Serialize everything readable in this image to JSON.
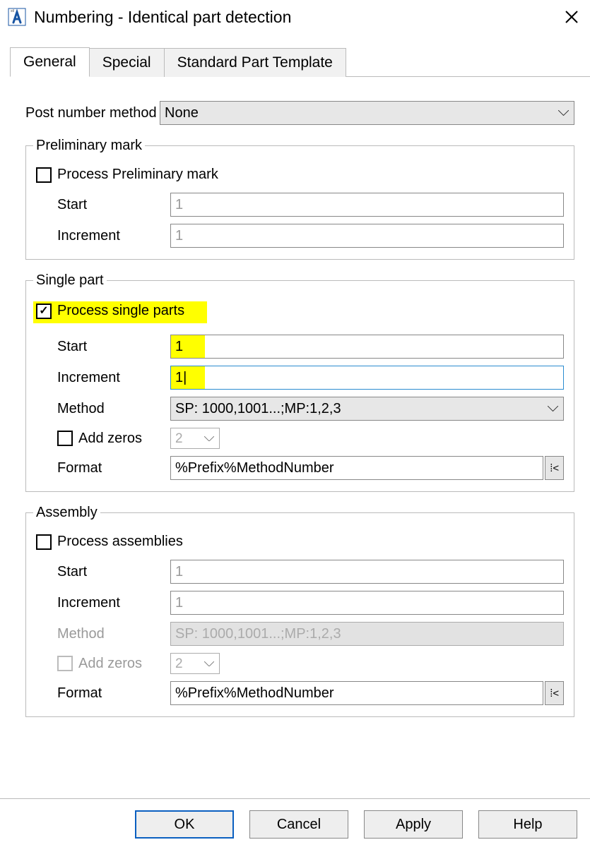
{
  "title": "Numbering - Identical part detection",
  "tabs": {
    "general": "General",
    "special": "Special",
    "template": "Standard Part Template"
  },
  "labels": {
    "post_method": "Post number method",
    "start": "Start",
    "increment": "Increment",
    "method": "Method",
    "add_zeros": "Add zeros",
    "format": "Format"
  },
  "post_method": {
    "value": "None"
  },
  "preliminary": {
    "legend": "Preliminary mark",
    "process_label": "Process Preliminary mark",
    "process_checked": false,
    "start": "1",
    "increment": "1"
  },
  "single": {
    "legend": "Single part",
    "process_label": "Process single parts",
    "process_checked": true,
    "start": "1",
    "increment": "1",
    "method": "SP: 1000,1001...;MP:1,2,3",
    "add_zeros_checked": false,
    "zeros": "2",
    "format": "%Prefix%MethodNumber"
  },
  "assembly": {
    "legend": "Assembly",
    "process_label": "Process assemblies",
    "process_checked": false,
    "start": "1",
    "increment": "1",
    "method": "SP: 1000,1001...;MP:1,2,3",
    "add_zeros_checked": false,
    "zeros": "2",
    "format": "%Prefix%MethodNumber"
  },
  "buttons": {
    "ok": "OK",
    "cancel": "Cancel",
    "apply": "Apply",
    "help": "Help"
  },
  "picker_glyph": "⁞<"
}
